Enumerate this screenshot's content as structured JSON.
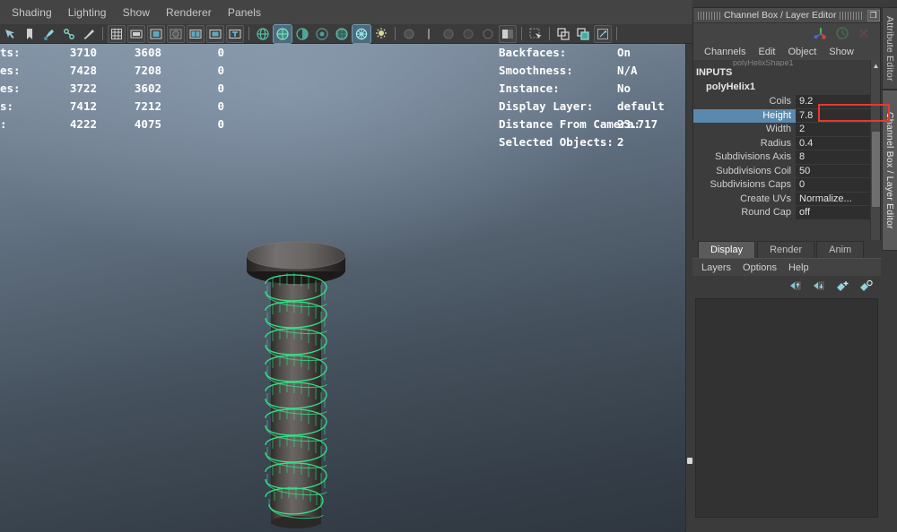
{
  "panel": {
    "menus": [
      "Shading",
      "Lighting",
      "Show",
      "Renderer",
      "Panels"
    ],
    "toolbar_icons": [
      "select-tool-icon",
      "bookmark-icon",
      "paint-select-icon",
      "snap-icon",
      "sculpt-icon",
      "grid-icon",
      "film-gate-icon",
      "resolution-gate-icon",
      "field-chart-icon",
      "safe-action-icon",
      "safe-title-icon",
      "camera-name-icon",
      "wireframe-shading-icon",
      "smooth-shade-all-icon",
      "smooth-shade-selected-icon",
      "flat-shade-icon",
      "textured-icon",
      "use-all-lights-icon",
      "shadows-icon",
      "ambient-occlusion-icon",
      "motion-blur-icon",
      "multisample-icon",
      "isolate-select-icon",
      "xray-icon",
      "xray-joints-icon",
      "xray-active-components-icon"
    ]
  },
  "hud": {
    "stats": {
      "rows": [
        {
          "label": "ts:",
          "c1": "3710",
          "c2": "3608",
          "c3": "0"
        },
        {
          "label": "es:",
          "c1": "7428",
          "c2": "7208",
          "c3": "0"
        },
        {
          "label": "es:",
          "c1": "3722",
          "c2": "3602",
          "c3": "0"
        },
        {
          "label": "s:",
          "c1": "7412",
          "c2": "7212",
          "c3": "0"
        },
        {
          "label": ":",
          "c1": "4222",
          "c2": "4075",
          "c3": "0"
        }
      ]
    },
    "info": [
      {
        "label": "Backfaces:",
        "value": "On"
      },
      {
        "label": "Smoothness:",
        "value": "N/A"
      },
      {
        "label": "Instance:",
        "value": "No"
      },
      {
        "label": "Display Layer:",
        "value": "default"
      },
      {
        "label": "Distance From Camera:",
        "value": "23.717"
      },
      {
        "label": "Selected Objects:",
        "value": "2"
      }
    ]
  },
  "vertical_tabs": [
    {
      "label": "Attribute Editor",
      "active": false
    },
    {
      "label": "Channel Box / Layer Editor",
      "active": true
    }
  ],
  "channel_box": {
    "title": "Channel Box / Layer Editor",
    "restore_label": "❐",
    "close_label": "✕",
    "menus": [
      "Channels",
      "Edit",
      "Object",
      "Show"
    ],
    "clipped_text": "polyHelixShape1",
    "section": "INPUTS",
    "node": "polyHelix1",
    "attributes": [
      {
        "name": "Coils",
        "value": "9.2",
        "selected": false
      },
      {
        "name": "Height",
        "value": "7.8",
        "selected": true
      },
      {
        "name": "Width",
        "value": "2",
        "selected": false
      },
      {
        "name": "Radius",
        "value": "0.4",
        "selected": false
      },
      {
        "name": "Subdivisions Axis",
        "value": "8",
        "selected": false
      },
      {
        "name": "Subdivisions Coil",
        "value": "50",
        "selected": false
      },
      {
        "name": "Subdivisions Caps",
        "value": "0",
        "selected": false
      },
      {
        "name": "Create UVs",
        "value": "Normalize...",
        "selected": false
      },
      {
        "name": "Round Cap",
        "value": "off",
        "selected": false
      }
    ]
  },
  "layer_editor": {
    "tabs": [
      {
        "label": "Display",
        "active": true
      },
      {
        "label": "Render",
        "active": false
      },
      {
        "label": "Anim",
        "active": false
      }
    ],
    "menus": [
      "Layers",
      "Options",
      "Help"
    ],
    "buttons": [
      "move-layer-up-icon",
      "move-layer-down-icon",
      "new-empty-layer-icon",
      "new-layer-from-selected-icon"
    ]
  },
  "colors": {
    "accent_selection": "#5a89ad",
    "annotation_red": "#e8392c",
    "selected_mesh_green": "#35e888",
    "panel_bg": "#3b3b3b",
    "field_bg": "#2e2e2e"
  }
}
